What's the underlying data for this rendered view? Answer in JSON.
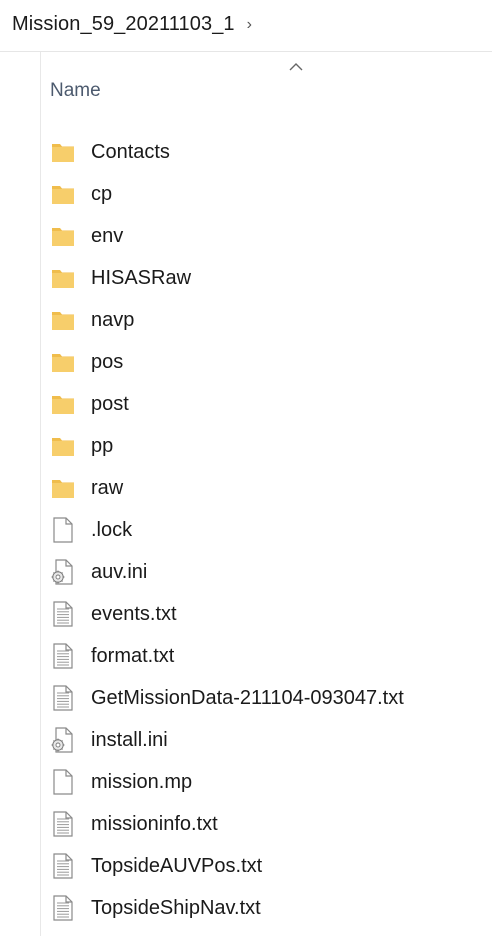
{
  "breadcrumb": {
    "folder": "Mission_59_20211103_1",
    "chevron": "›"
  },
  "column_header": {
    "name": "Name",
    "sort_icon": "sort-up-icon"
  },
  "colors": {
    "folder_fill": "#f7ce6b",
    "folder_tab": "#f0bd4c",
    "file_outline": "#8a8a8a",
    "header_text": "#4c5a6e"
  },
  "items": [
    {
      "name": "Contacts",
      "kind": "folder"
    },
    {
      "name": "cp",
      "kind": "folder"
    },
    {
      "name": "env",
      "kind": "folder"
    },
    {
      "name": "HISASRaw",
      "kind": "folder"
    },
    {
      "name": "navp",
      "kind": "folder"
    },
    {
      "name": "pos",
      "kind": "folder"
    },
    {
      "name": "post",
      "kind": "folder"
    },
    {
      "name": "pp",
      "kind": "folder"
    },
    {
      "name": "raw",
      "kind": "folder"
    },
    {
      "name": ".lock",
      "kind": "blank"
    },
    {
      "name": "auv.ini",
      "kind": "settings"
    },
    {
      "name": "events.txt",
      "kind": "text"
    },
    {
      "name": "format.txt",
      "kind": "text"
    },
    {
      "name": "GetMissionData-211104-093047.txt",
      "kind": "text"
    },
    {
      "name": "install.ini",
      "kind": "settings"
    },
    {
      "name": "mission.mp",
      "kind": "blank"
    },
    {
      "name": "missioninfo.txt",
      "kind": "text"
    },
    {
      "name": "TopsideAUVPos.txt",
      "kind": "text"
    },
    {
      "name": "TopsideShipNav.txt",
      "kind": "text"
    }
  ]
}
